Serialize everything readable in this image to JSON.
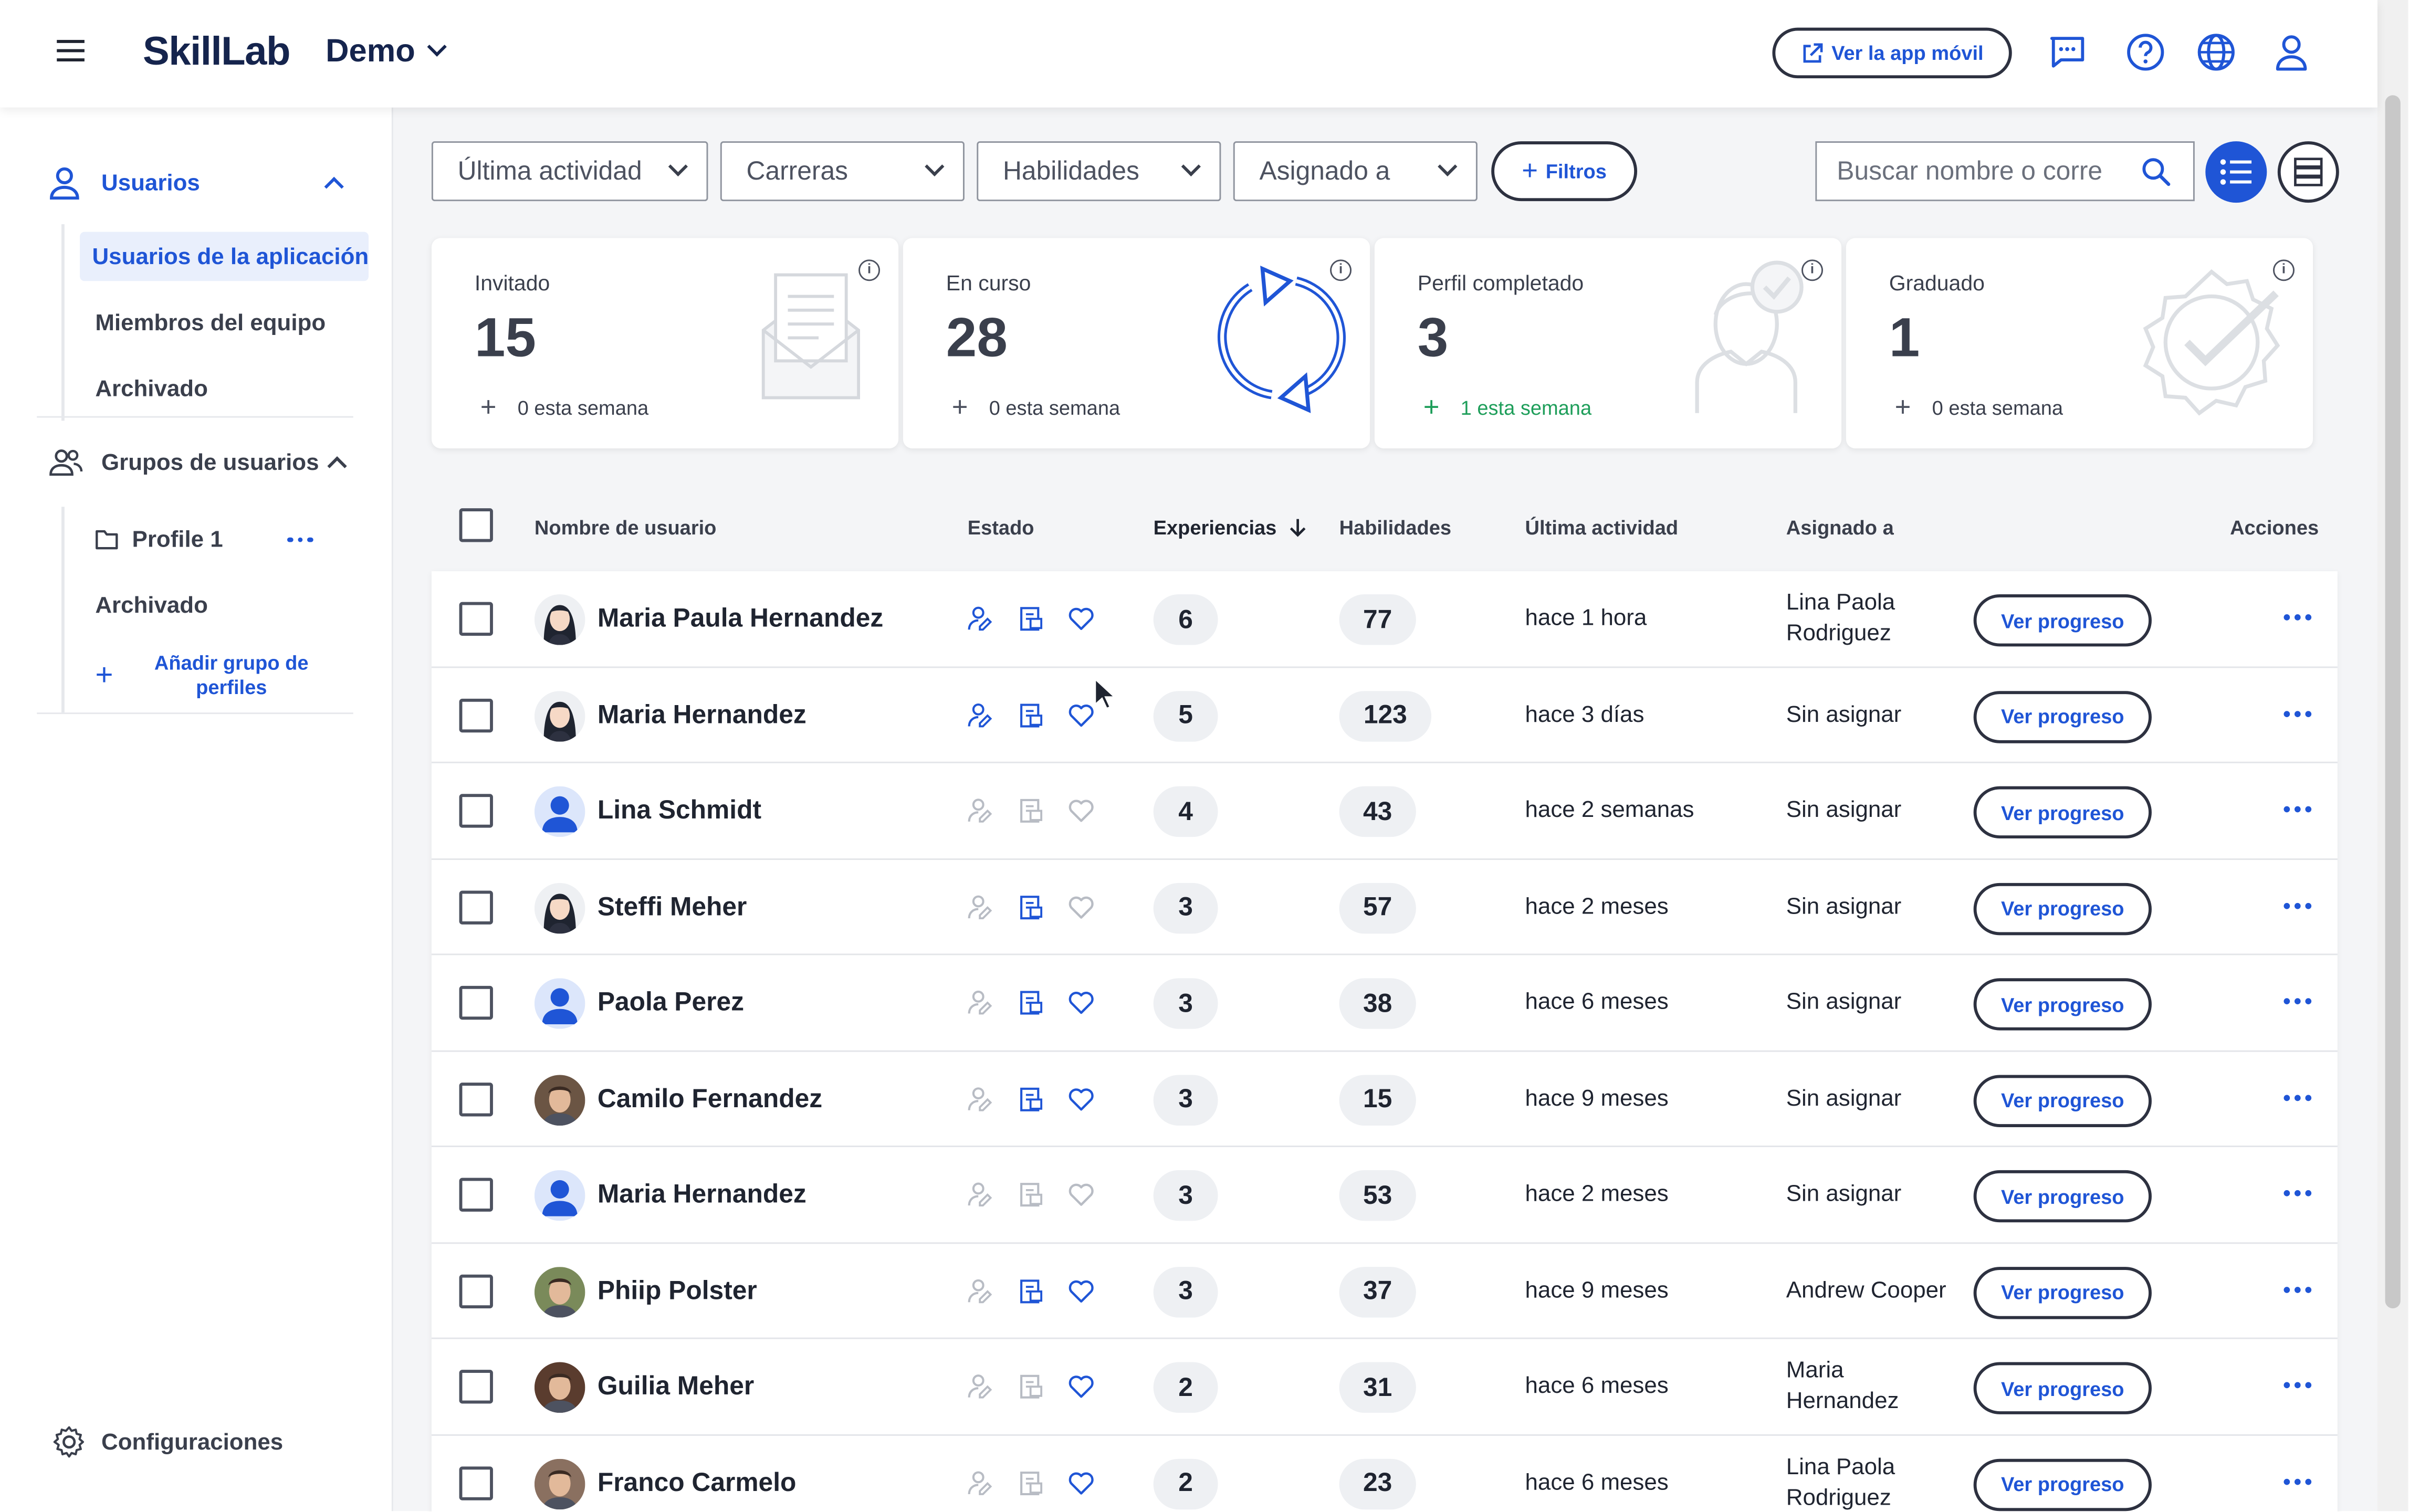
{
  "header": {
    "brand": "SkillLab",
    "org": "Demo",
    "mobile_btn": "Ver la app móvil",
    "icons": [
      "chat-icon",
      "help-icon",
      "globe-icon",
      "user-icon"
    ]
  },
  "sidebar": {
    "usuarios": "Usuarios",
    "usuarios_items": [
      "Usuarios de la aplicación",
      "Miembros del equipo",
      "Archivado"
    ],
    "grupos": "Grupos de usuarios",
    "profile": "Profile 1",
    "grupos_archivado": "Archivado",
    "add_group": "Añadir grupo de perfiles",
    "settings": "Configuraciones"
  },
  "filters": {
    "f1": "Última actividad",
    "f2": "Carreras",
    "f3": "Habilidades",
    "f4": "Asignado a",
    "filtros": "Filtros",
    "search_placeholder": "Buscar nombre o corre"
  },
  "cards": [
    {
      "label": "Invitado",
      "value": "15",
      "week": "0 esta semana",
      "highlight": false
    },
    {
      "label": "En curso",
      "value": "28",
      "week": "0 esta semana",
      "highlight": false
    },
    {
      "label": "Perfil completado",
      "value": "3",
      "week": "1 esta semana",
      "highlight": true
    },
    {
      "label": "Graduado",
      "value": "1",
      "week": "0 esta semana",
      "highlight": false
    }
  ],
  "table": {
    "headers": {
      "name": "Nombre de usuario",
      "status": "Estado",
      "exp": "Experiencias",
      "skills": "Habilidades",
      "last": "Última actividad",
      "assigned": "Asignado a",
      "actions": "Acciones"
    },
    "view_progress": "Ver progreso",
    "rows": [
      {
        "name": "Maria Paula Hernandez",
        "avatar": "female",
        "status": [
          1,
          1,
          1
        ],
        "exp": "6",
        "skills": "77",
        "last": "hace 1 hora",
        "assigned": "Lina Paola Rodriguez"
      },
      {
        "name": "Maria Hernandez",
        "avatar": "female",
        "status": [
          1,
          1,
          1
        ],
        "exp": "5",
        "skills": "123",
        "last": "hace 3 días",
        "assigned": "Sin asignar"
      },
      {
        "name": "Lina Schmidt",
        "avatar": "default",
        "status": [
          0,
          0,
          0
        ],
        "exp": "4",
        "skills": "43",
        "last": "hace 2 semanas",
        "assigned": "Sin asignar"
      },
      {
        "name": "Steffi Meher",
        "avatar": "female",
        "status": [
          0,
          1,
          0
        ],
        "exp": "3",
        "skills": "57",
        "last": "hace 2 meses",
        "assigned": "Sin asignar"
      },
      {
        "name": "Paola Perez",
        "avatar": "default",
        "status": [
          0,
          1,
          1
        ],
        "exp": "3",
        "skills": "38",
        "last": "hace 6 meses",
        "assigned": "Sin asignar"
      },
      {
        "name": "Camilo Fernandez",
        "avatar": "photo-dark",
        "status": [
          0,
          1,
          1
        ],
        "exp": "3",
        "skills": "15",
        "last": "hace 9 meses",
        "assigned": "Sin asignar"
      },
      {
        "name": "Maria Hernandez",
        "avatar": "default",
        "status": [
          0,
          0,
          0
        ],
        "exp": "3",
        "skills": "53",
        "last": "hace 2 meses",
        "assigned": "Sin asignar"
      },
      {
        "name": "Phiip Polster",
        "avatar": "photo-green",
        "status": [
          0,
          1,
          1
        ],
        "exp": "3",
        "skills": "37",
        "last": "hace 9 meses",
        "assigned": "Andrew Cooper"
      },
      {
        "name": "Guilia Meher",
        "avatar": "photo-woman",
        "status": [
          0,
          0,
          1
        ],
        "exp": "2",
        "skills": "31",
        "last": "hace 6 meses",
        "assigned": "Maria Hernandez"
      },
      {
        "name": "Franco Carmelo",
        "avatar": "photo-man",
        "status": [
          0,
          0,
          1
        ],
        "exp": "2",
        "skills": "23",
        "last": "hace 6 meses",
        "assigned": "Lina Paola Rodriguez"
      }
    ]
  },
  "colors": {
    "accent": "#1f55d6",
    "text": "#1f2430",
    "green": "#1e9e5a"
  }
}
